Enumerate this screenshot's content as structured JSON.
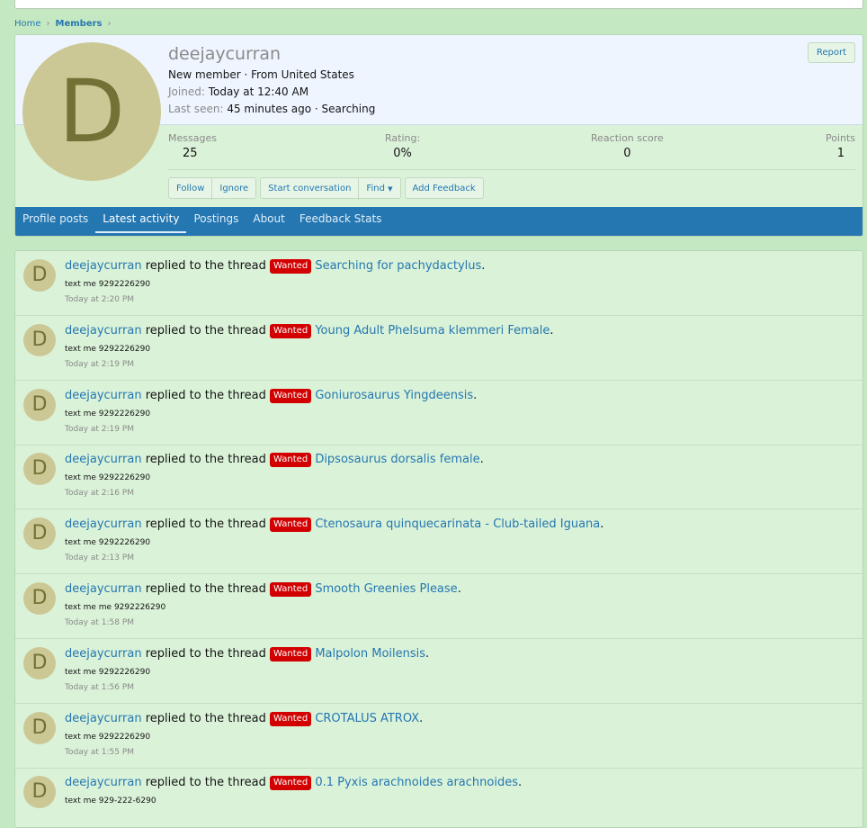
{
  "breadcrumb": {
    "home": "Home",
    "members": "Members",
    "sep": "›"
  },
  "profile": {
    "avatar_letter": "D",
    "username": "deejaycurran",
    "title_line": "New member · From United States",
    "joined_label": "Joined:",
    "joined_value": "Today at 12:40 AM",
    "last_seen_label": "Last seen:",
    "last_seen_value": "45 minutes ago · Searching",
    "report_label": "Report"
  },
  "stats": [
    {
      "label": "Messages",
      "value": "25"
    },
    {
      "label": "Rating:",
      "value": "0%"
    },
    {
      "label": "Reaction score",
      "value": "0"
    },
    {
      "label": "Points",
      "value": "1"
    }
  ],
  "actions": {
    "follow": "Follow",
    "ignore": "Ignore",
    "start_conversation": "Start conversation",
    "find": "Find",
    "add_feedback": "Add Feedback"
  },
  "tabs": [
    "Profile posts",
    "Latest activity",
    "Postings",
    "About",
    "Feedback Stats"
  ],
  "active_tab": "Latest activity",
  "colors": {
    "accent": "#2577b1",
    "wanted": "#d20000",
    "page_bg": "#c4e8c2",
    "avatar_bg": "#cbc896"
  },
  "activity": {
    "user": "deejaycurran",
    "verb": " replied to the thread ",
    "prefix": "Wanted",
    "items": [
      {
        "thread": "Searching for pachydactylus",
        "snippet": "text me 9292226290",
        "time": "Today at 2:20 PM"
      },
      {
        "thread": "Young Adult Phelsuma klemmeri Female",
        "snippet": "text me 9292226290",
        "time": "Today at 2:19 PM"
      },
      {
        "thread": "Goniurosaurus Yingdeensis",
        "snippet": "text me 9292226290",
        "time": "Today at 2:19 PM"
      },
      {
        "thread": "Dipsosaurus dorsalis female",
        "snippet": "text me 9292226290",
        "time": "Today at 2:16 PM"
      },
      {
        "thread": "Ctenosaura quinquecarinata - Club-tailed Iguana",
        "snippet": "text me 9292226290",
        "time": "Today at 2:13 PM"
      },
      {
        "thread": "Smooth Greenies Please",
        "snippet": "text me me 9292226290",
        "time": "Today at 1:58 PM"
      },
      {
        "thread": "Malpolon Moilensis",
        "snippet": "text me 9292226290",
        "time": "Today at 1:56 PM"
      },
      {
        "thread": "CROTALUS ATROX",
        "snippet": "text me 9292226290",
        "time": "Today at 1:55 PM"
      },
      {
        "thread": "0.1 Pyxis arachnoides arachnoides",
        "snippet": "text me 929-222-6290",
        "time": ""
      }
    ]
  }
}
